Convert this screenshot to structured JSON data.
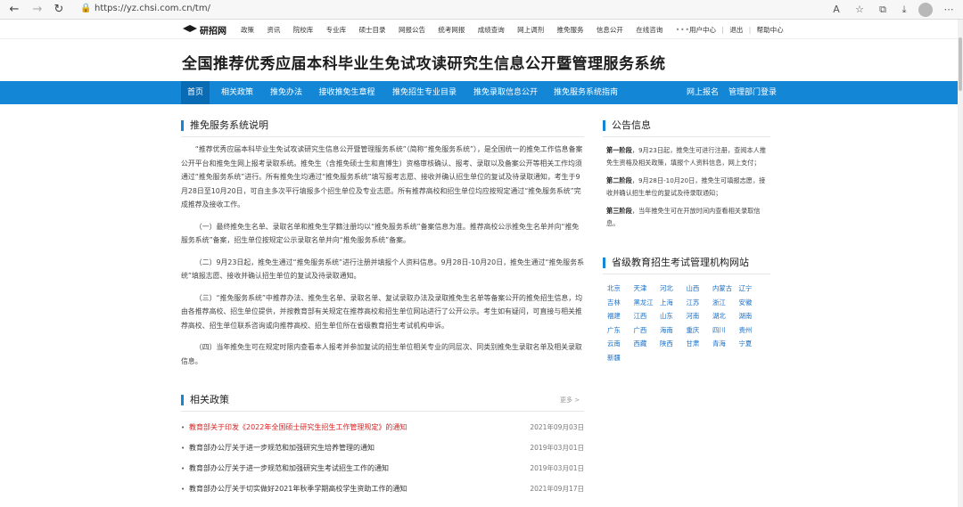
{
  "browser": {
    "url": "https://yz.chsi.com.cn/tm/"
  },
  "header": {
    "logo_text": "研招网",
    "nav": [
      "政策",
      "资讯",
      "院校库",
      "专业库",
      "硕士目录",
      "网报公告",
      "统考网报",
      "成绩查询",
      "网上调剂",
      "推免服务",
      "信息公开",
      "在线咨询"
    ],
    "nav_more": "•••",
    "user_center": "用户中心",
    "logout": "退出",
    "help": "帮助中心",
    "sep": "|"
  },
  "site_title": "全国推荐优秀应届本科毕业生免试攻读研究生信息公开暨管理服务系统",
  "menu": {
    "items": [
      "首页",
      "相关政策",
      "推免办法",
      "接收推免生章程",
      "推免招生专业目录",
      "推免录取信息公开",
      "推免服务系统指南"
    ],
    "right": [
      "网上报名",
      "管理部门登录"
    ]
  },
  "intro": {
    "title": "推免服务系统说明",
    "paragraphs": [
      "“推荐优秀应届本科毕业生免试攻读研究生信息公开暨管理服务系统”（简称“推免服务系统”），是全国统一的推免工作信息备案公开平台和推免生网上报考录取系统。推免生（含推免硕士生和直博生）资格审核确认、报考、录取以及备案公开等相关工作均须通过“推免服务系统”进行。所有推免生均通过“推免服务系统”填写报考志愿、接收并确认招生单位的复试及待录取通知，考生于9月28日至10月20日，可自主多次平行填报多个招生单位及专业志愿。所有推荐高校和招生单位均应按规定通过“推免服务系统”完成推荐及接收工作。",
      "（一）最终推免生名单、录取名单和推免生学籍注册均以“推免服务系统”备案信息为准。推荐高校公示推免生名单并向“推免服务系统”备案，招生单位按规定公示录取名单并向“推免服务系统”备案。",
      "（二）9月23日起，推免生通过“推免服务系统”进行注册并填报个人资料信息。9月28日-10月20日，推免生通过“推免服务系统”填报志愿、接收并确认招生单位的复试及待录取通知。",
      "（三）“推免服务系统”中推荐办法、推免生名单、录取名单、复试录取办法及录取推免生名单等备案公开的推免招生信息，均由各推荐高校、招生单位提供，并按教育部有关规定在推荐高校和招生单位网站进行了公开公示。考生如有疑问，可直接与相关推荐高校、招生单位联系咨询或向推荐高校、招生单位所在省级教育招生考试机构申诉。",
      "（四）当年推免生可在规定时限内查看本人报考并参加复试的招生单位相关专业的同层次、同类别推免生录取名单及相关录取信息。"
    ]
  },
  "policy": {
    "title": "相关政策",
    "more": "更多 >",
    "bullet": "•",
    "items": [
      {
        "title": "教育部关于印发《2022年全国硕士研究生招生工作管理规定》的通知",
        "date": "2021年09月03日"
      },
      {
        "title": "教育部办公厅关于进一步规范和加强研究生培养管理的通知",
        "date": "2019年03月01日"
      },
      {
        "title": "教育部办公厅关于进一步规范和加强研究生考试招生工作的通知",
        "date": "2019年03月01日"
      },
      {
        "title": "教育部办公厅关于切实做好2021年秋季学期高校学生资助工作的通知",
        "date": "2021年09月17日"
      }
    ]
  },
  "notice": {
    "title": "公告信息",
    "items": [
      {
        "stage": "第一阶段",
        "text": "，9月23日起，推免生可进行注册，查阅本人推免生资格及相关政策，填报个人资料信息，网上支付；"
      },
      {
        "stage": "第二阶段",
        "text": "，9月28日-10月20日，推免生可填报志愿，接收并确认招生单位的复试及待录取通知；"
      },
      {
        "stage": "第三阶段",
        "text": "，当年推免生可在开放时间内查看相关录取信息。"
      }
    ]
  },
  "provinces": {
    "title": "省级教育招生考试管理机构网站",
    "items": [
      "北京",
      "天津",
      "河北",
      "山西",
      "内蒙古",
      "辽宁",
      "吉林",
      "黑龙江",
      "上海",
      "江苏",
      "浙江",
      "安徽",
      "福建",
      "江西",
      "山东",
      "河南",
      "湖北",
      "湖南",
      "广东",
      "广西",
      "海南",
      "重庆",
      "四川",
      "贵州",
      "云南",
      "西藏",
      "陕西",
      "甘肃",
      "青海",
      "宁夏",
      "新疆"
    ]
  },
  "colors": {
    "primary": "#1386d6",
    "active_menu": "#0a6bb5",
    "highlight": "#d82323",
    "link": "#1a6fc6"
  }
}
